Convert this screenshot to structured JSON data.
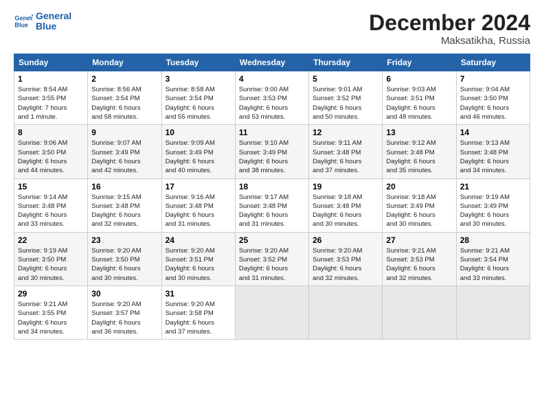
{
  "header": {
    "logo_line1": "General",
    "logo_line2": "Blue",
    "month": "December 2024",
    "location": "Maksatikha, Russia"
  },
  "weekdays": [
    "Sunday",
    "Monday",
    "Tuesday",
    "Wednesday",
    "Thursday",
    "Friday",
    "Saturday"
  ],
  "weeks": [
    [
      {
        "day": "1",
        "sunrise": "8:54 AM",
        "sunset": "3:55 PM",
        "daylight": "7 hours and 1 minute."
      },
      {
        "day": "2",
        "sunrise": "8:56 AM",
        "sunset": "3:54 PM",
        "daylight": "6 hours and 58 minutes."
      },
      {
        "day": "3",
        "sunrise": "8:58 AM",
        "sunset": "3:54 PM",
        "daylight": "6 hours and 55 minutes."
      },
      {
        "day": "4",
        "sunrise": "9:00 AM",
        "sunset": "3:53 PM",
        "daylight": "6 hours and 53 minutes."
      },
      {
        "day": "5",
        "sunrise": "9:01 AM",
        "sunset": "3:52 PM",
        "daylight": "6 hours and 50 minutes."
      },
      {
        "day": "6",
        "sunrise": "9:03 AM",
        "sunset": "3:51 PM",
        "daylight": "6 hours and 48 minutes."
      },
      {
        "day": "7",
        "sunrise": "9:04 AM",
        "sunset": "3:50 PM",
        "daylight": "6 hours and 46 minutes."
      }
    ],
    [
      {
        "day": "8",
        "sunrise": "9:06 AM",
        "sunset": "3:50 PM",
        "daylight": "6 hours and 44 minutes."
      },
      {
        "day": "9",
        "sunrise": "9:07 AM",
        "sunset": "3:49 PM",
        "daylight": "6 hours and 42 minutes."
      },
      {
        "day": "10",
        "sunrise": "9:09 AM",
        "sunset": "3:49 PM",
        "daylight": "6 hours and 40 minutes."
      },
      {
        "day": "11",
        "sunrise": "9:10 AM",
        "sunset": "3:49 PM",
        "daylight": "6 hours and 38 minutes."
      },
      {
        "day": "12",
        "sunrise": "9:11 AM",
        "sunset": "3:48 PM",
        "daylight": "6 hours and 37 minutes."
      },
      {
        "day": "13",
        "sunrise": "9:12 AM",
        "sunset": "3:48 PM",
        "daylight": "6 hours and 35 minutes."
      },
      {
        "day": "14",
        "sunrise": "9:13 AM",
        "sunset": "3:48 PM",
        "daylight": "6 hours and 34 minutes."
      }
    ],
    [
      {
        "day": "15",
        "sunrise": "9:14 AM",
        "sunset": "3:48 PM",
        "daylight": "6 hours and 33 minutes."
      },
      {
        "day": "16",
        "sunrise": "9:15 AM",
        "sunset": "3:48 PM",
        "daylight": "6 hours and 32 minutes."
      },
      {
        "day": "17",
        "sunrise": "9:16 AM",
        "sunset": "3:48 PM",
        "daylight": "6 hours and 31 minutes."
      },
      {
        "day": "18",
        "sunrise": "9:17 AM",
        "sunset": "3:48 PM",
        "daylight": "6 hours and 31 minutes."
      },
      {
        "day": "19",
        "sunrise": "9:18 AM",
        "sunset": "3:48 PM",
        "daylight": "6 hours and 30 minutes."
      },
      {
        "day": "20",
        "sunrise": "9:18 AM",
        "sunset": "3:49 PM",
        "daylight": "6 hours and 30 minutes."
      },
      {
        "day": "21",
        "sunrise": "9:19 AM",
        "sunset": "3:49 PM",
        "daylight": "6 hours and 30 minutes."
      }
    ],
    [
      {
        "day": "22",
        "sunrise": "9:19 AM",
        "sunset": "3:50 PM",
        "daylight": "6 hours and 30 minutes."
      },
      {
        "day": "23",
        "sunrise": "9:20 AM",
        "sunset": "3:50 PM",
        "daylight": "6 hours and 30 minutes."
      },
      {
        "day": "24",
        "sunrise": "9:20 AM",
        "sunset": "3:51 PM",
        "daylight": "6 hours and 30 minutes."
      },
      {
        "day": "25",
        "sunrise": "9:20 AM",
        "sunset": "3:52 PM",
        "daylight": "6 hours and 31 minutes."
      },
      {
        "day": "26",
        "sunrise": "9:20 AM",
        "sunset": "3:53 PM",
        "daylight": "6 hours and 32 minutes."
      },
      {
        "day": "27",
        "sunrise": "9:21 AM",
        "sunset": "3:53 PM",
        "daylight": "6 hours and 32 minutes."
      },
      {
        "day": "28",
        "sunrise": "9:21 AM",
        "sunset": "3:54 PM",
        "daylight": "6 hours and 33 minutes."
      }
    ],
    [
      {
        "day": "29",
        "sunrise": "9:21 AM",
        "sunset": "3:55 PM",
        "daylight": "6 hours and 34 minutes."
      },
      {
        "day": "30",
        "sunrise": "9:20 AM",
        "sunset": "3:57 PM",
        "daylight": "6 hours and 36 minutes."
      },
      {
        "day": "31",
        "sunrise": "9:20 AM",
        "sunset": "3:58 PM",
        "daylight": "6 hours and 37 minutes."
      },
      null,
      null,
      null,
      null
    ]
  ]
}
